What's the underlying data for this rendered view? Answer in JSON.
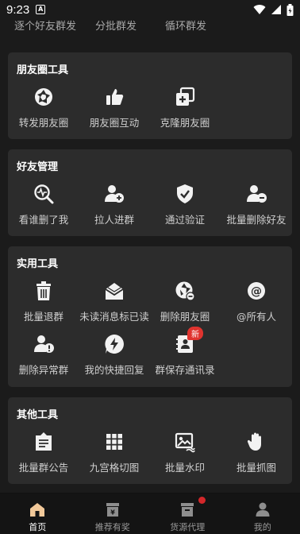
{
  "status": {
    "time": "9:23",
    "badge": "A"
  },
  "top_row": [
    "逐个好友群发",
    "分批群发",
    "循环群发"
  ],
  "sections": [
    {
      "title": "朋友圈工具",
      "tools": [
        {
          "label": "转发朋友圈",
          "icon": "shutter-icon"
        },
        {
          "label": "朋友圈互动",
          "icon": "thumbs-up-icon"
        },
        {
          "label": "克隆朋友圈",
          "icon": "clone-add-icon"
        }
      ]
    },
    {
      "title": "好友管理",
      "tools": [
        {
          "label": "看谁删了我",
          "icon": "search-pulse-icon"
        },
        {
          "label": "拉人进群",
          "icon": "pull-person-icon"
        },
        {
          "label": "通过验证",
          "icon": "shield-check-icon"
        },
        {
          "label": "批量删除好友",
          "icon": "user-minus-icon"
        }
      ]
    },
    {
      "title": "实用工具",
      "tools": [
        {
          "label": "批量退群",
          "icon": "trash-icon"
        },
        {
          "label": "未读消息标已读",
          "icon": "open-envelope-icon"
        },
        {
          "label": "删除朋友圈",
          "icon": "shutter-delete-icon"
        },
        {
          "label": "@所有人",
          "icon": "at-icon"
        },
        {
          "label": "删除异常群",
          "icon": "user-warning-icon"
        },
        {
          "label": "我的快捷回复",
          "icon": "lightning-bubble-icon"
        },
        {
          "label": "群保存通讯录",
          "icon": "contacts-book-icon",
          "badge": "新"
        }
      ]
    },
    {
      "title": "其他工具",
      "tools": [
        {
          "label": "批量群公告",
          "icon": "announcement-icon"
        },
        {
          "label": "九宫格切图",
          "icon": "grid-icon"
        },
        {
          "label": "批量水印",
          "icon": "image-watermark-icon"
        },
        {
          "label": "批量抓图",
          "icon": "grab-hand-icon"
        }
      ]
    }
  ],
  "tabs": [
    {
      "label": "首页",
      "icon": "home-icon",
      "active": true
    },
    {
      "label": "推荐有奖",
      "icon": "reward-box-icon",
      "active": false
    },
    {
      "label": "货源代理",
      "icon": "store-box-icon",
      "active": false,
      "dot": true
    },
    {
      "label": "我的",
      "icon": "profile-icon",
      "active": false
    }
  ],
  "colors": {
    "background": "#1b1b1b",
    "card": "#2c2c2c",
    "icon": "#f2f2f2",
    "badge": "#e0342f"
  }
}
